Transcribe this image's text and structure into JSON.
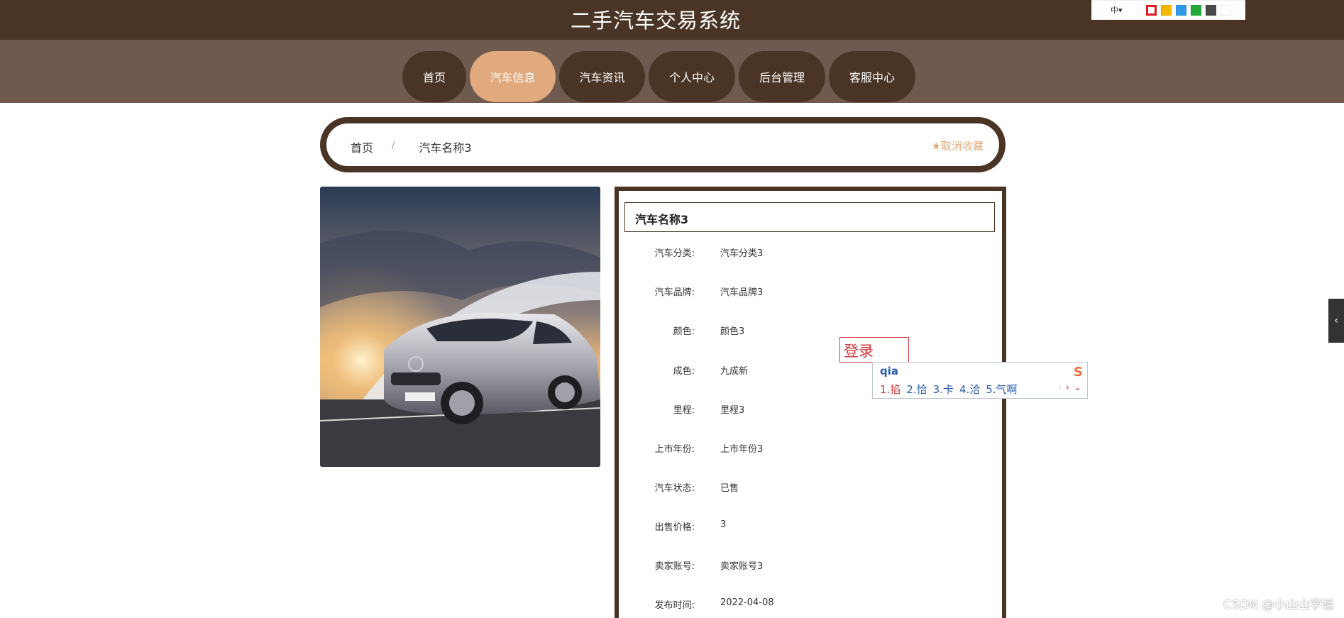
{
  "site": {
    "title": "二手汽车交易系统"
  },
  "nav": [
    "首页",
    "汽车信息",
    "汽车资讯",
    "个人中心",
    "后台管理",
    "客服中心"
  ],
  "theme": {
    "lang": "中▾",
    "swatches": [
      "#e0141e",
      "#f5b800",
      "#2f9ae5",
      "#21a93a",
      "#4a4a4a",
      "#ffffff"
    ]
  },
  "breadcrumb": {
    "home": "首页",
    "sep": "/",
    "current": "汽车名称3",
    "fav": "取消收藏"
  },
  "detail": {
    "title": "汽车名称3",
    "fields": [
      {
        "label": "汽车分类:",
        "value": "汽车分类3"
      },
      {
        "label": "汽车品牌:",
        "value": "汽车品牌3"
      },
      {
        "label": "颜色:",
        "value": "颜色3"
      },
      {
        "label": "成色:",
        "value": "九成新"
      },
      {
        "label": "里程:",
        "value": "里程3"
      },
      {
        "label": "上市年份:",
        "value": "上市年份3"
      },
      {
        "label": "汽车状态:",
        "value": "已售"
      },
      {
        "label": "出售价格:",
        "value": "3"
      },
      {
        "label": "卖家账号:",
        "value": "卖家账号3"
      },
      {
        "label": "发布时间:",
        "value": "2022-04-08"
      }
    ]
  },
  "ime": {
    "popup": "登录",
    "input": "qia",
    "candidates": [
      "1.掐",
      "2.恰",
      "3.卡",
      "4.洽",
      "5.气啊"
    ],
    "logo": "S"
  },
  "watermark": "CSDN @小山山学姐"
}
